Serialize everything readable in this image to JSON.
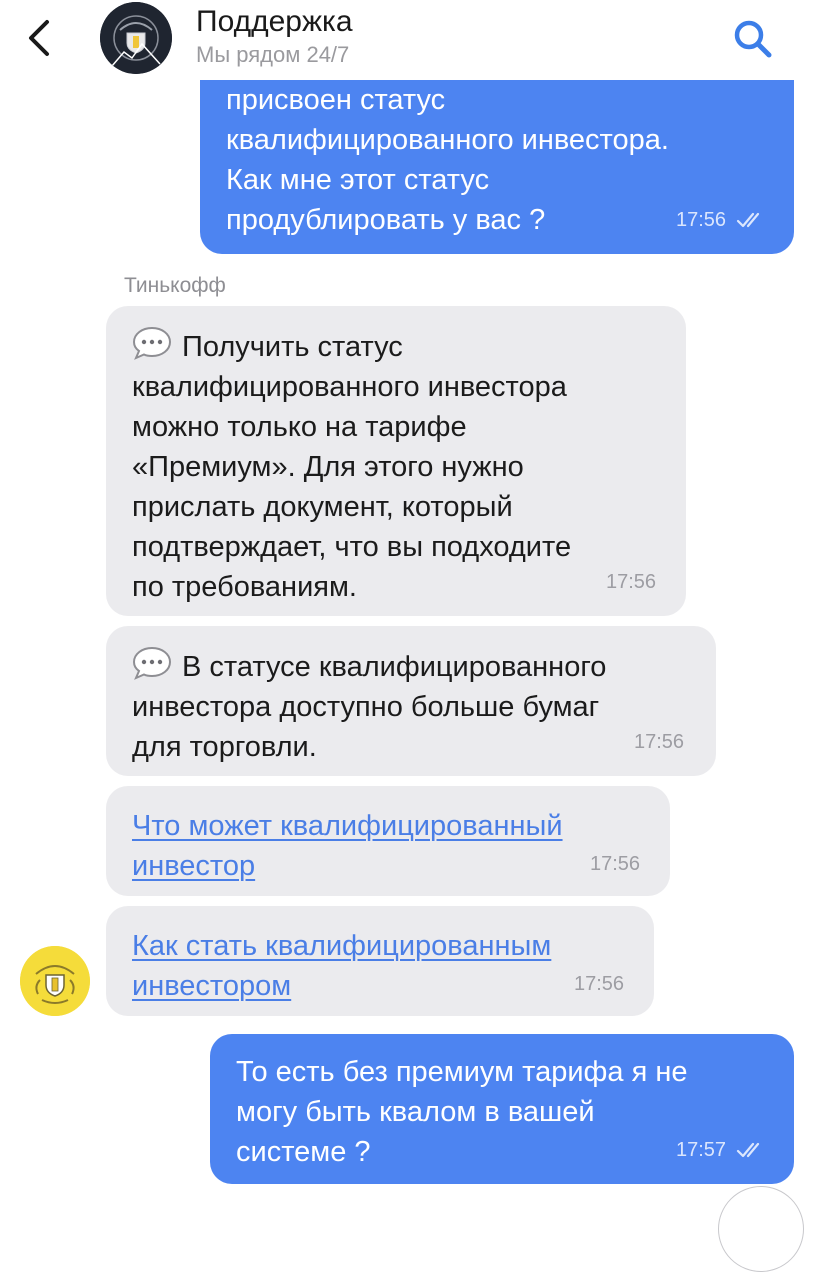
{
  "header": {
    "title": "Поддержка",
    "subtitle": "Мы рядом 24/7",
    "back_icon": "chevron-left-icon",
    "search_icon": "search-icon",
    "accent_color": "#3c7ee8"
  },
  "messages": {
    "out1": {
      "text": "присвоен статус\nквалифицированного инвестора.\nКак мне этот статус\nпродублировать у вас ?",
      "time": "17:56"
    },
    "sender": "Тинькофф",
    "in1": {
      "text": "Получить статус\nквалифицированного инвестора\nможно только на тарифе\n«Премиум». Для этого нужно\nприслать документ, который\nподтверждает, что вы подходите\nпо требованиям.",
      "time": "17:56"
    },
    "in2": {
      "text": "В статусе квалифицированного\nинвестора доступно больше бумаг\nдля торговли.",
      "time": "17:56"
    },
    "link1": {
      "text": "Что может квалифицированный\nинвестор",
      "time": "17:56"
    },
    "link2": {
      "text": "Как стать квалифицированным\nинвестором",
      "time": "17:56"
    },
    "out2": {
      "text": "То есть без премиум тарифа я не\nмогу быть квалом в вашей\nсистеме ?",
      "time": "17:57"
    }
  },
  "colors": {
    "outgoing_bubble": "#4d84f1",
    "incoming_bubble": "#ebebee",
    "link": "#4a7ee6",
    "bot_avatar": "#f5dc3a"
  }
}
